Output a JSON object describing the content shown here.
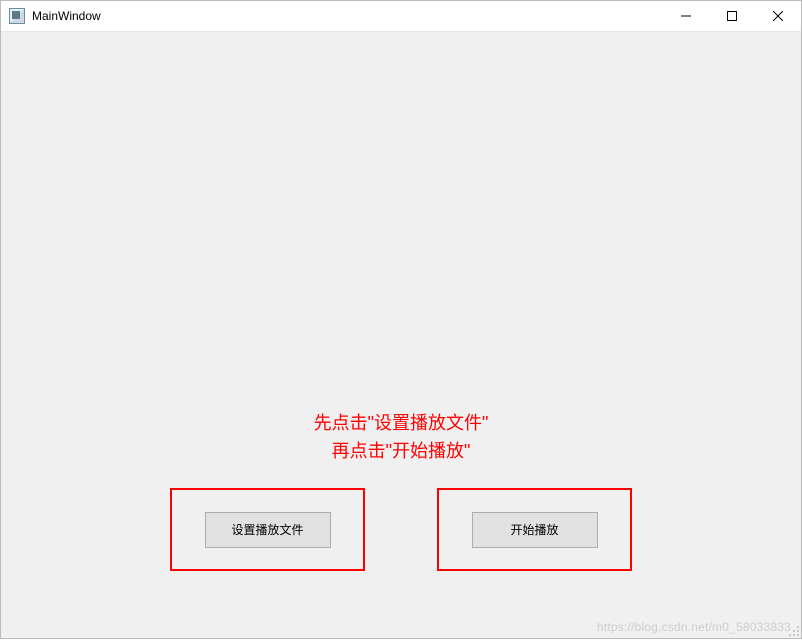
{
  "window": {
    "title": "MainWindow"
  },
  "instructions": {
    "line1": "先点击\"设置播放文件\"",
    "line2": "再点击\"开始播放\""
  },
  "buttons": {
    "set_file": "设置播放文件",
    "start_play": "开始播放"
  },
  "watermark": "https://blog.csdn.net/m0_58033833"
}
